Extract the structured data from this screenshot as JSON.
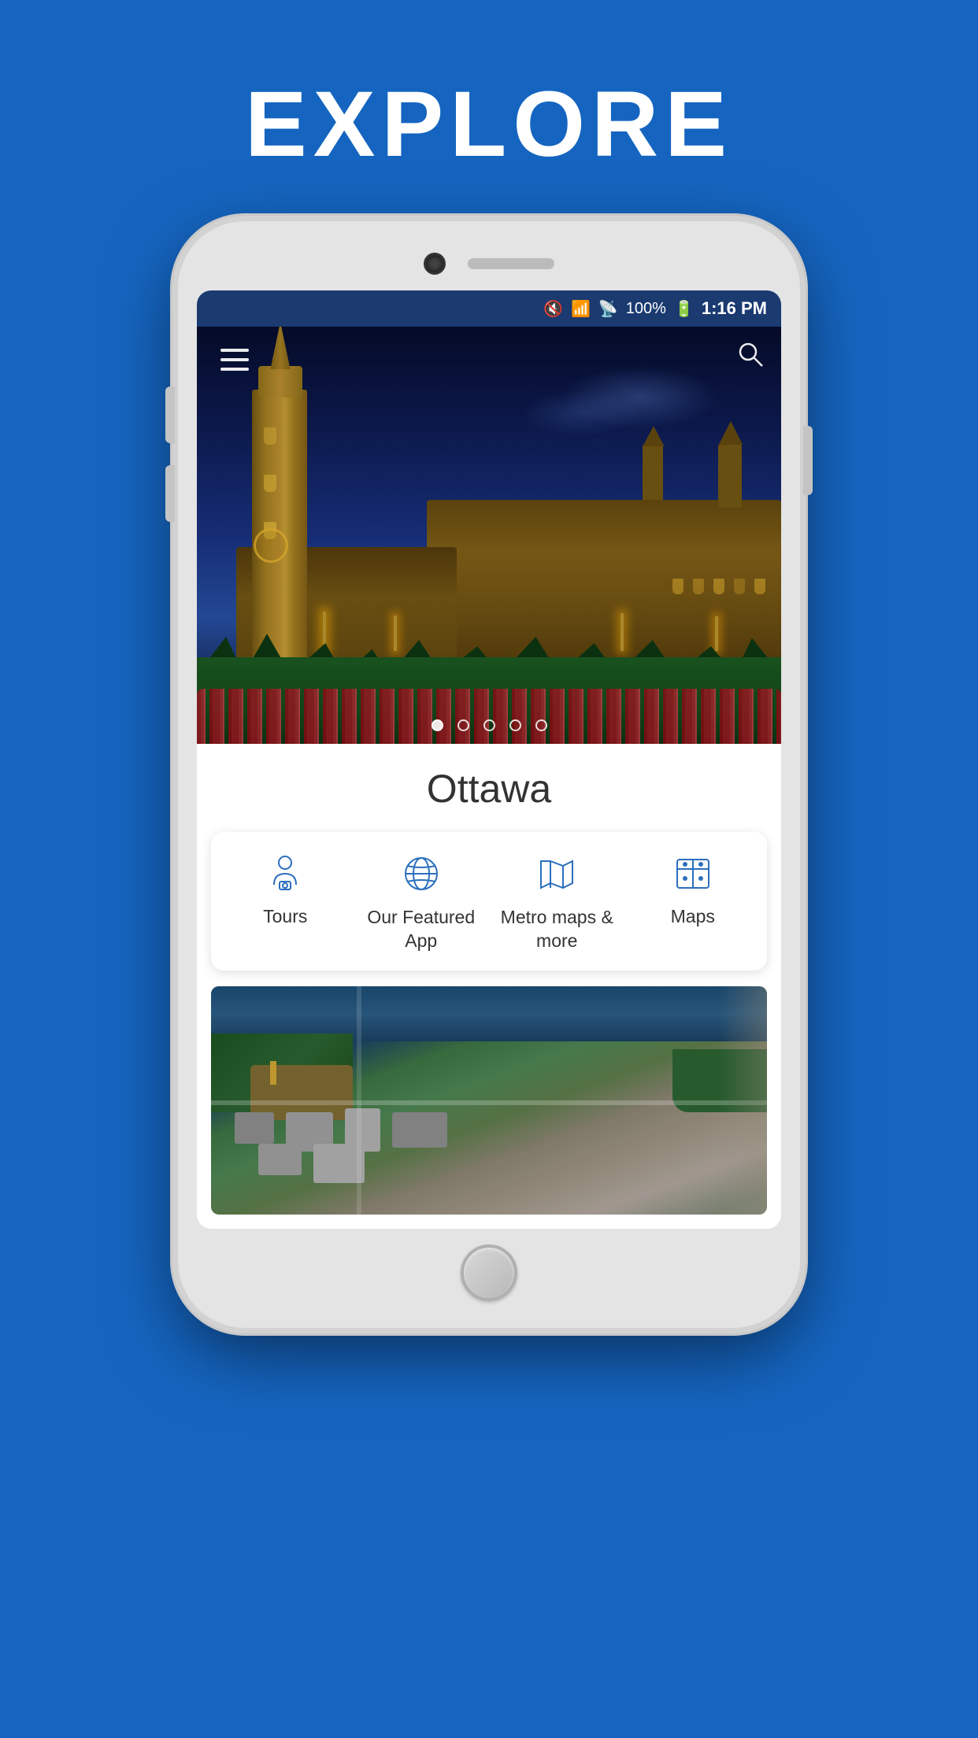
{
  "page": {
    "title": "EXPLORE",
    "background_color": "#1565C0"
  },
  "status_bar": {
    "time": "1:16 PM",
    "battery": "100%",
    "signal_icon": "📶",
    "wifi_icon": "WiFi",
    "mute_icon": "🔇"
  },
  "hero": {
    "menu_label": "Menu",
    "search_label": "Search",
    "dots": [
      {
        "active": true
      },
      {
        "active": false
      },
      {
        "active": false
      },
      {
        "active": false
      },
      {
        "active": false
      }
    ]
  },
  "app": {
    "city_name": "Ottawa",
    "categories": [
      {
        "id": "tours",
        "label": "Tours",
        "icon": "person"
      },
      {
        "id": "featured-app",
        "label": "Our Featured App",
        "icon": "globe"
      },
      {
        "id": "metro-maps",
        "label": "Metro maps & more",
        "icon": "map-fold"
      },
      {
        "id": "maps",
        "label": "Maps",
        "icon": "map-grid"
      }
    ]
  }
}
